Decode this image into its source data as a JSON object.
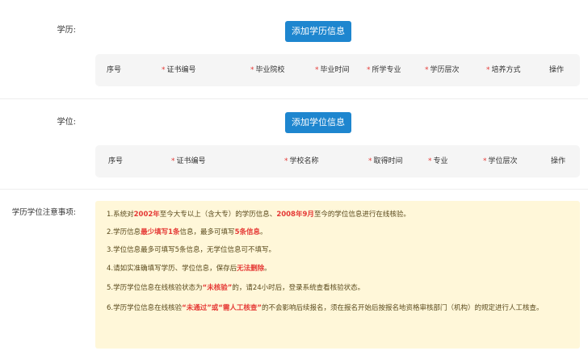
{
  "education": {
    "label": "学历:",
    "add_button": "添加学历信息",
    "columns": [
      {
        "text": "序号",
        "required": false
      },
      {
        "text": "证书编号",
        "required": true
      },
      {
        "text": "毕业院校",
        "required": true
      },
      {
        "text": "毕业时间",
        "required": true
      },
      {
        "text": "所学专业",
        "required": true
      },
      {
        "text": "学历层次",
        "required": true
      },
      {
        "text": "培养方式",
        "required": true
      },
      {
        "text": "操作",
        "required": false
      }
    ]
  },
  "degree": {
    "label": "学位:",
    "add_button": "添加学位信息",
    "columns": [
      {
        "text": "序号",
        "required": false
      },
      {
        "text": "证书编号",
        "required": true
      },
      {
        "text": "学校名称",
        "required": true
      },
      {
        "text": "取得时间",
        "required": true
      },
      {
        "text": "专业",
        "required": true
      },
      {
        "text": "学位层次",
        "required": true
      },
      {
        "text": "操作",
        "required": false
      }
    ]
  },
  "notice": {
    "label": "学历学位注意事项:",
    "items": [
      {
        "parts": [
          {
            "t": "1.系统对",
            "hl": false
          },
          {
            "t": "2002年",
            "hl": true
          },
          {
            "t": "至今大专以上（含大专）的学历信息、",
            "hl": false
          },
          {
            "t": "2008年9月",
            "hl": true
          },
          {
            "t": "至今的学位信息进行在线核验。",
            "hl": false
          }
        ]
      },
      {
        "parts": [
          {
            "t": "2.学历信息",
            "hl": false
          },
          {
            "t": "最少填写1条",
            "hl": true
          },
          {
            "t": "信息，最多可填写",
            "hl": false
          },
          {
            "t": "5条信息",
            "hl": true
          },
          {
            "t": "。",
            "hl": false
          }
        ]
      },
      {
        "parts": [
          {
            "t": "3.学位信息最多可填写5条信息，无学位信息可不填写。",
            "hl": false
          }
        ]
      },
      {
        "parts": [
          {
            "t": "4.请如实准确填写学历、学位信息，保存后",
            "hl": false
          },
          {
            "t": "无法删除",
            "hl": true
          },
          {
            "t": "。",
            "hl": false
          }
        ]
      },
      {
        "parts": [
          {
            "t": "5.学历学位信息在线核验状态为",
            "hl": false
          },
          {
            "t": "“未核验”",
            "hl": true
          },
          {
            "t": "的，请24小时后，登录系统查看核验状态。",
            "hl": false
          }
        ]
      },
      {
        "parts": [
          {
            "t": "6.学历学位信息在线核验",
            "hl": false
          },
          {
            "t": "“未通过”或“需人工核查”",
            "hl": true
          },
          {
            "t": "的不会影响后续报名，须在报名开始后按报名地资格审核部门（机构）的规定进行人工核查。",
            "hl": false
          }
        ]
      }
    ]
  }
}
